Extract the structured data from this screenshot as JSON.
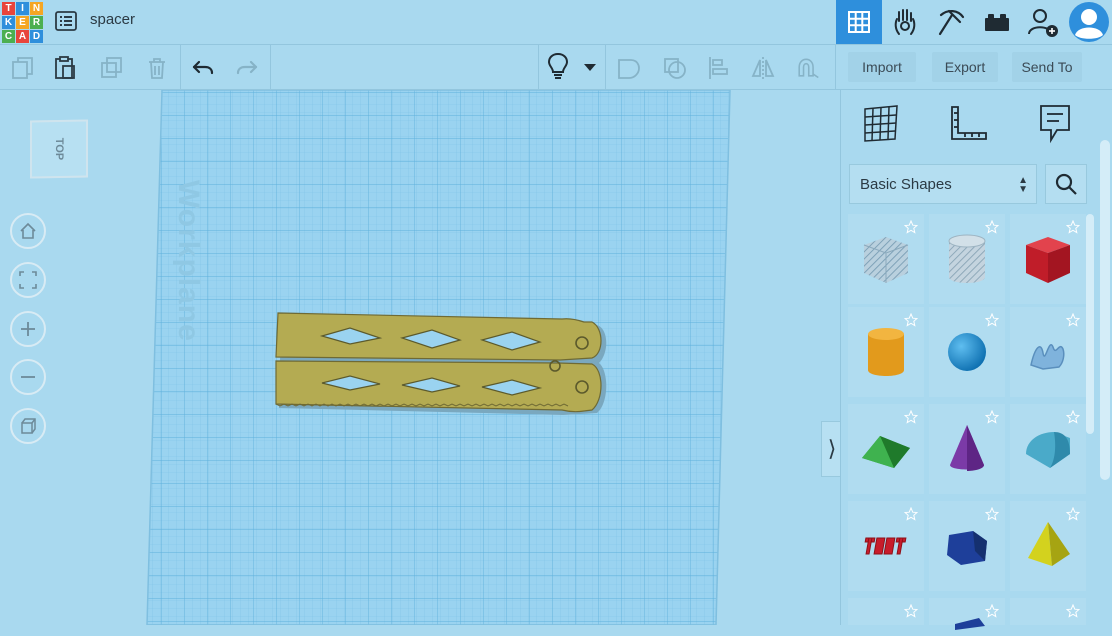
{
  "app": {
    "logo_letters": [
      "T",
      "I",
      "N",
      "K",
      "E",
      "R",
      "C",
      "A",
      "D"
    ],
    "logo_colors": [
      "#e8453c",
      "#2e8fdc",
      "#f5a623",
      "#2e8fdc",
      "#f5a623",
      "#4caf50",
      "#4caf50",
      "#e8453c",
      "#2e8fdc"
    ],
    "document_title": "spacer"
  },
  "top_nav": {
    "items": [
      {
        "name": "3d-design-grid-icon",
        "active": true
      },
      {
        "name": "circuits-hand-icon",
        "active": false
      },
      {
        "name": "minecraft-pickaxe-icon",
        "active": false
      },
      {
        "name": "lego-brick-icon",
        "active": false
      },
      {
        "name": "invite-user-icon",
        "active": false
      },
      {
        "name": "user-avatar-icon",
        "active": false
      }
    ],
    "active_color": "#2e8fdc"
  },
  "toolbar": {
    "import_label": "Import",
    "export_label": "Export",
    "send_to_label": "Send To"
  },
  "workplane": {
    "label": "Workplane",
    "viewcube_label": "TOP",
    "shape_color": "#b4ab52"
  },
  "panel": {
    "library_selected": "Basic Shapes",
    "shapes": [
      {
        "name": "box-hole-shape",
        "color": "#9fbfd4"
      },
      {
        "name": "cylinder-hole-shape",
        "color": "#b5c8d6"
      },
      {
        "name": "box-shape",
        "color": "#d01f2d"
      },
      {
        "name": "cylinder-shape",
        "color": "#e59a1b"
      },
      {
        "name": "sphere-shape",
        "color": "#1f8fd0"
      },
      {
        "name": "scribble-shape",
        "color": "#78a9d6"
      },
      {
        "name": "roof-shape",
        "color": "#2e9c3c"
      },
      {
        "name": "cone-shape",
        "color": "#7b3aa7"
      },
      {
        "name": "round-roof-shape",
        "color": "#4aaac9"
      },
      {
        "name": "text-shape",
        "color": "#d01f2d"
      },
      {
        "name": "polygon-shape",
        "color": "#1e3f9a"
      },
      {
        "name": "pyramid-shape",
        "color": "#c6c514"
      }
    ]
  }
}
